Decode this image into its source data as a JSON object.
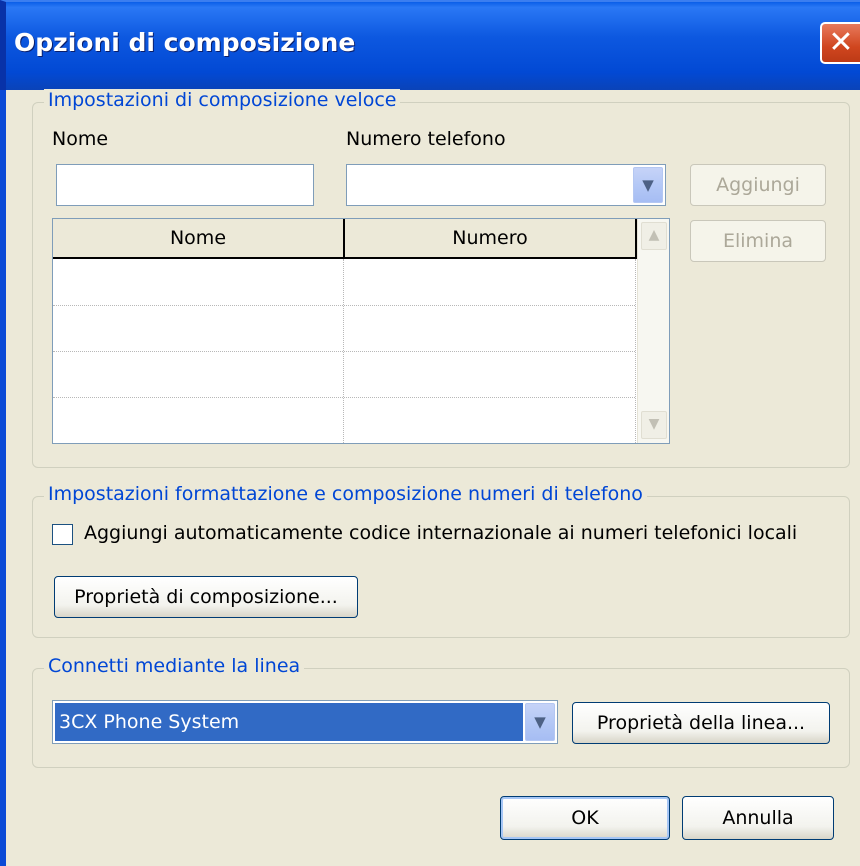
{
  "window": {
    "title": "Opzioni di composizione",
    "close_glyph": "✕"
  },
  "speed_dial": {
    "legend": "Impostazioni di composizione veloce",
    "name_label": "Nome",
    "phone_label": "Numero telefono",
    "name_value": "",
    "phone_value": "",
    "add_button": "Aggiungi",
    "delete_button": "Elimina",
    "columns": [
      "Nome",
      "Numero"
    ],
    "rows": []
  },
  "formatting": {
    "legend": "Impostazioni formattazione e composizione numeri di telefono",
    "checkbox_label": "Aggiungi automaticamente codice internazionale ai numeri telefonici locali",
    "checkbox_checked": false,
    "properties_button": "Proprietà di composizione..."
  },
  "line": {
    "legend": "Connetti mediante la linea",
    "selected": "3CX Phone System",
    "properties_button": "Proprietà della linea..."
  },
  "footer": {
    "ok_button": "OK",
    "cancel_button": "Annulla"
  },
  "icons": {
    "dropdown": "chevron-down-icon",
    "scroll_up": "chevron-up-icon",
    "scroll_down": "chevron-down-icon",
    "close": "close-icon"
  }
}
